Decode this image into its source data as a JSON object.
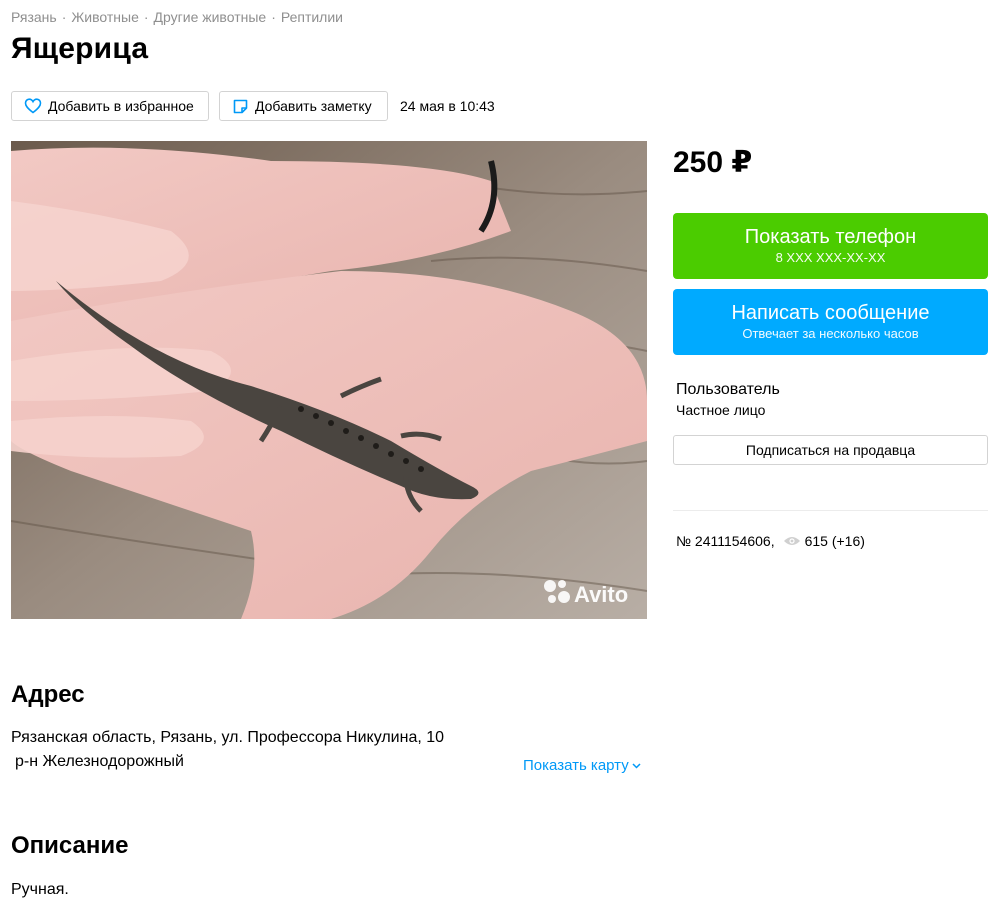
{
  "breadcrumbs": [
    "Рязань",
    "Животные",
    "Другие животные",
    "Рептилии"
  ],
  "title": "Ящерица",
  "actions": {
    "favorite_label": "Добавить в избранное",
    "note_label": "Добавить заметку",
    "date": "24 мая в 10:43"
  },
  "photo": {
    "watermark": "Avito"
  },
  "price": "250 ₽",
  "phone_button": {
    "label": "Показать телефон",
    "sub": "8 XXX XXX-XX-XX"
  },
  "message_button": {
    "label": "Написать сообщение",
    "sub": "Отвечает за несколько часов"
  },
  "seller": {
    "name": "Пользователь",
    "type": "Частное лицо",
    "subscribe_label": "Подписаться на продавца"
  },
  "meta": {
    "number": "№ 2411154606,",
    "views": "615 (+16)"
  },
  "address": {
    "title": "Адрес",
    "line1": "Рязанская область, Рязань, ул. Профессора Никулина, 10",
    "line2": "р-н Железнодорожный",
    "show_map": "Показать карту"
  },
  "description": {
    "title": "Описание",
    "text": "Ручная."
  },
  "colors": {
    "phone_button": "#4bcc00",
    "message_button": "#00aaff",
    "link": "#0099f7"
  }
}
